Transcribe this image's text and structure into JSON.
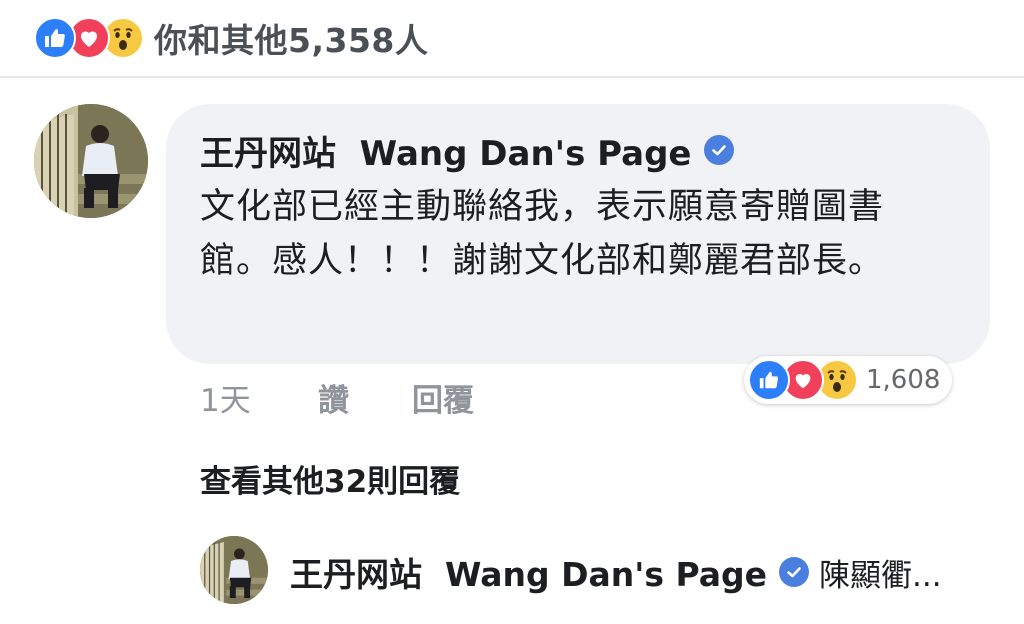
{
  "summary": {
    "reactions": [
      "like-icon",
      "love-icon",
      "wow-icon"
    ],
    "text": "你和其他5,358人"
  },
  "comment": {
    "author": "王丹网站  Wang Dan's Page",
    "verified": true,
    "text": "文化部已經主動聯絡我，表示願意寄贈圖書館。感人！！！謝謝文化部和鄭麗君部長。",
    "reactions": [
      "like-icon",
      "love-icon",
      "wow-icon"
    ],
    "reaction_count": "1,608",
    "time": "1天",
    "like_label": "讚",
    "reply_label": "回覆"
  },
  "view_more": {
    "label": "查看其他32則回覆"
  },
  "reply_preview": {
    "author": "王丹网站  Wang Dan's Page",
    "verified": true,
    "snippet": "陳顯衢..."
  },
  "colors": {
    "like": "#2d7ff9",
    "love": "#f0405a",
    "wow": "#f7c942",
    "bubble": "#f0f2f5",
    "verified": "#4a7fe0",
    "muted_text": "#90949c"
  }
}
